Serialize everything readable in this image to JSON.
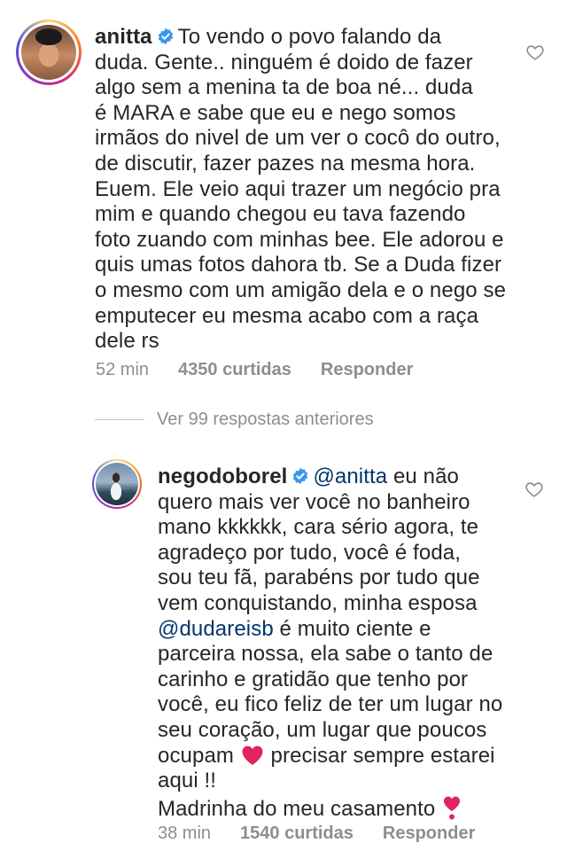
{
  "comments": [
    {
      "username": "anitta",
      "verified": true,
      "text_lines": [
        "To vendo o povo falando da",
        "duda. Gente.. ninguém é doido de fazer",
        "algo sem a menina ta de boa né... duda",
        "é MARA e sabe que eu e nego somos",
        "irmãos do nivel de um ver o cocô do outro,",
        "de discutir, fazer pazes na mesma hora.",
        "Euem. Ele veio aqui trazer um negócio pra",
        "mim e quando chegou eu tava fazendo",
        "foto zuando com minhas bee. Ele adorou e",
        "quis umas fotos dahora tb. Se a Duda fizer",
        "o mesmo com um amigão dela e o nego se",
        "emputecer eu mesma acabo com a raça",
        "dele rs"
      ],
      "time": "52 min",
      "likes": "4350 curtidas",
      "reply": "Responder"
    },
    {
      "username": "negodoborel",
      "verified": true,
      "mention": "@anitta",
      "line1_rest": " eu não",
      "text_lines": [
        "quero mais ver você no banheiro",
        "mano kkkkkk, cara sério agora, te",
        "agradeço por tudo, você é foda,",
        "sou teu fã, parabéns por tudo que",
        "vem conquistando, minha esposa"
      ],
      "mention2": "@dudareisb",
      "mention2_rest": " é muito ciente e",
      "text_lines_b": [
        "parceira nossa, ela sabe o tanto de",
        "carinho e gratidão que tenho por",
        "você, eu fico feliz de ter um lugar no",
        "seu coração, um lugar que poucos"
      ],
      "line_emoji_a": "ocupam",
      "line_emoji_b": " precisar sempre estarei",
      "line_last1": "aqui !!",
      "line_last2": "Madrinha do meu casamento",
      "time": "38 min",
      "likes": "1540 curtidas",
      "reply": "Responder"
    }
  ],
  "view_replies": "Ver 99 respostas anteriores",
  "colors": {
    "text": "#262626",
    "meta": "#8e8e8e",
    "mention": "#00376b",
    "verified": "#3897f0",
    "heart_emoji": "#e0245e"
  },
  "icons": {
    "like": "heart-outline-icon",
    "verified": "verified-badge-icon",
    "emoji_heart": "red-heart-emoji",
    "emoji_exclaim": "heavy-heart-exclamation-emoji"
  }
}
